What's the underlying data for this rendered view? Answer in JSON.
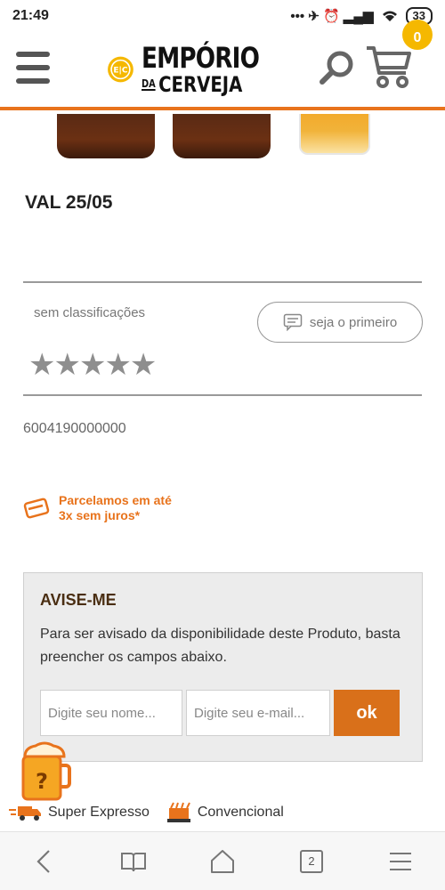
{
  "status_bar": {
    "time": "21:49",
    "icons": "••• ✈ ⏰ ▂▄▆",
    "battery": "33"
  },
  "header": {
    "logo_badge": "E|C",
    "logo_line1": "EMPÓRIO",
    "logo_da": "DA",
    "logo_line2": "CERVEJA",
    "cart_count": "0",
    "accent_color": "#e8731c"
  },
  "product": {
    "title": "VAL 25/05",
    "rating_label": "sem classificações",
    "review_button_label": "seja o primeiro",
    "stars": "★★★★★",
    "rating_value": 0,
    "sku": "6004190000000",
    "installments_line1": "Parcelamos em até",
    "installments_line2": "3x sem juros*"
  },
  "notify": {
    "title": "AVISE-ME",
    "description": "Para ser avisado da disponibilidade deste Produto, basta preencher os campos abaixo.",
    "name_placeholder": "Digite seu nome...",
    "email_placeholder": "Digite seu e-mail...",
    "submit_label": "ok"
  },
  "shipping": {
    "express_label": "Super Expresso",
    "conventional_label": "Convencional"
  },
  "bottom_nav": {
    "tab_count": "2"
  }
}
